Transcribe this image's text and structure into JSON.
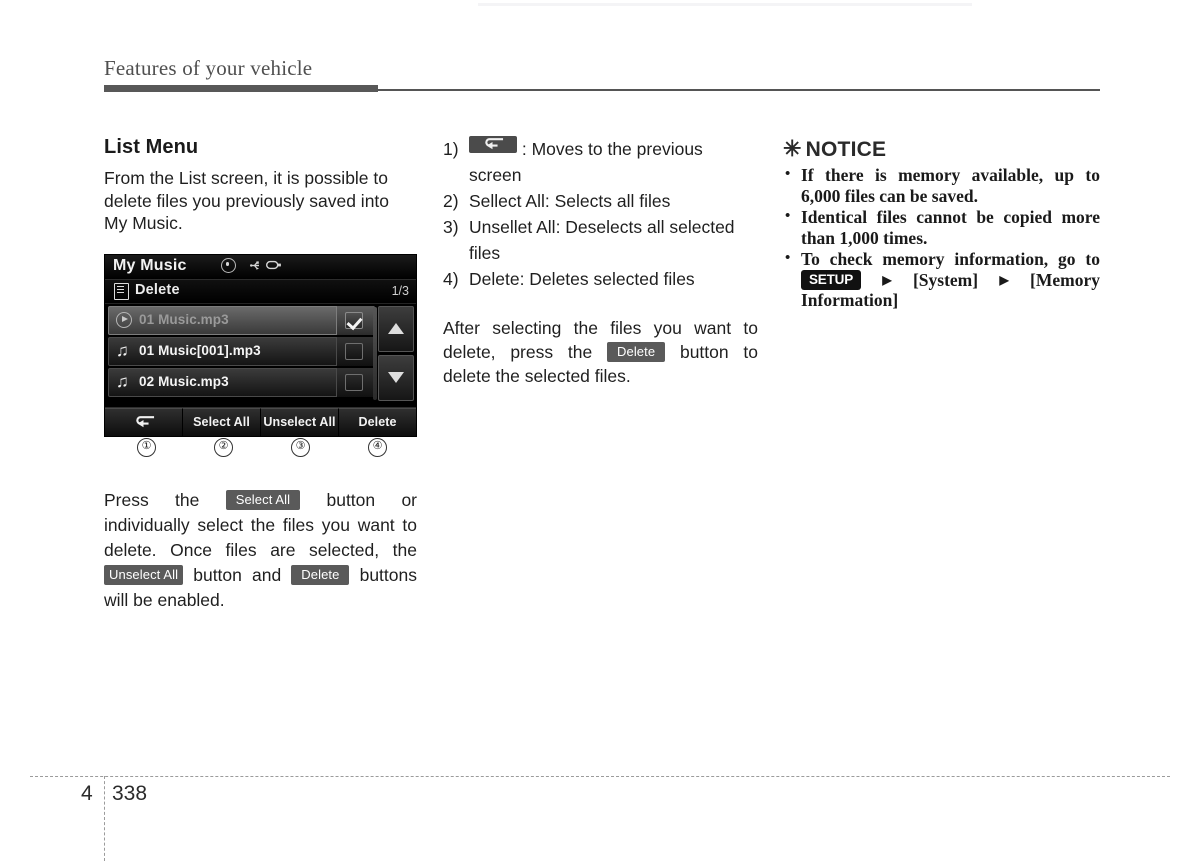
{
  "header": {
    "title": "Features of your vehicle"
  },
  "left": {
    "section_title": "List Menu",
    "intro": "From the List screen, it is possible to delete files you previously saved into My Music.",
    "device": {
      "title": "My Music",
      "status_icons": [
        "disc-icon",
        "usb-icon"
      ],
      "submenu_icon": "list-menu-icon",
      "submenu_label": "Delete",
      "page_indicator": "1/3",
      "rows": [
        {
          "icon": "play-circle-icon",
          "label": "01 Music.mp3",
          "checked": true,
          "selected": true
        },
        {
          "icon": "music-note-icon",
          "label": "01 Music[001].mp3",
          "checked": false,
          "selected": false
        },
        {
          "icon": "music-note-icon",
          "label": "02 Music.mp3",
          "checked": false,
          "selected": false
        }
      ],
      "scroll": {
        "up_icon": "triangle-up-icon",
        "down_icon": "triangle-down-icon"
      },
      "toolbar": [
        {
          "icon": "back-arrow-icon",
          "label": ""
        },
        {
          "icon": "",
          "label": "Select All"
        },
        {
          "icon": "",
          "label": "Unselect All"
        },
        {
          "icon": "",
          "label": "Delete"
        }
      ],
      "callouts": [
        "①",
        "②",
        "③",
        "④"
      ]
    },
    "instruction": {
      "part1": "Press the",
      "chip1": "Select All",
      "part2": "button or individually select the files you want to delete. Once files are selected, the",
      "chip2": "Unselect All",
      "part3": "button and",
      "chip3": "Delete",
      "part4": "buttons will be enabled."
    }
  },
  "middle": {
    "items": [
      {
        "num": "1)",
        "chip": "back-arrow-icon",
        "text": ": Moves to the previous screen"
      },
      {
        "num": "2)",
        "chip": "",
        "text": "Sellect All: Selects all files"
      },
      {
        "num": "3)",
        "chip": "",
        "text": "Unsellet All: Deselects all selected files"
      },
      {
        "num": "4)",
        "chip": "",
        "text": "Delete: Deletes selected files"
      }
    ],
    "paragraph": {
      "part1": "After selecting the files you want to delete, press the",
      "chip": "Delete",
      "part2": "button to delete the selected files."
    }
  },
  "right": {
    "notice_symbol": "✳",
    "notice_title": "NOTICE",
    "bullets": [
      {
        "text": "If there is memory available, up to 6,000 files can be saved."
      },
      {
        "text": "Identical files cannot be copied more than 1,000 times."
      }
    ],
    "bullet_setup": {
      "part1": "To check memory information, go to",
      "chip": "SETUP",
      "arrow": "▶",
      "part2": "[System]",
      "part3": "[Memory Information]"
    }
  },
  "footer": {
    "chapter": "4",
    "page": "338"
  }
}
